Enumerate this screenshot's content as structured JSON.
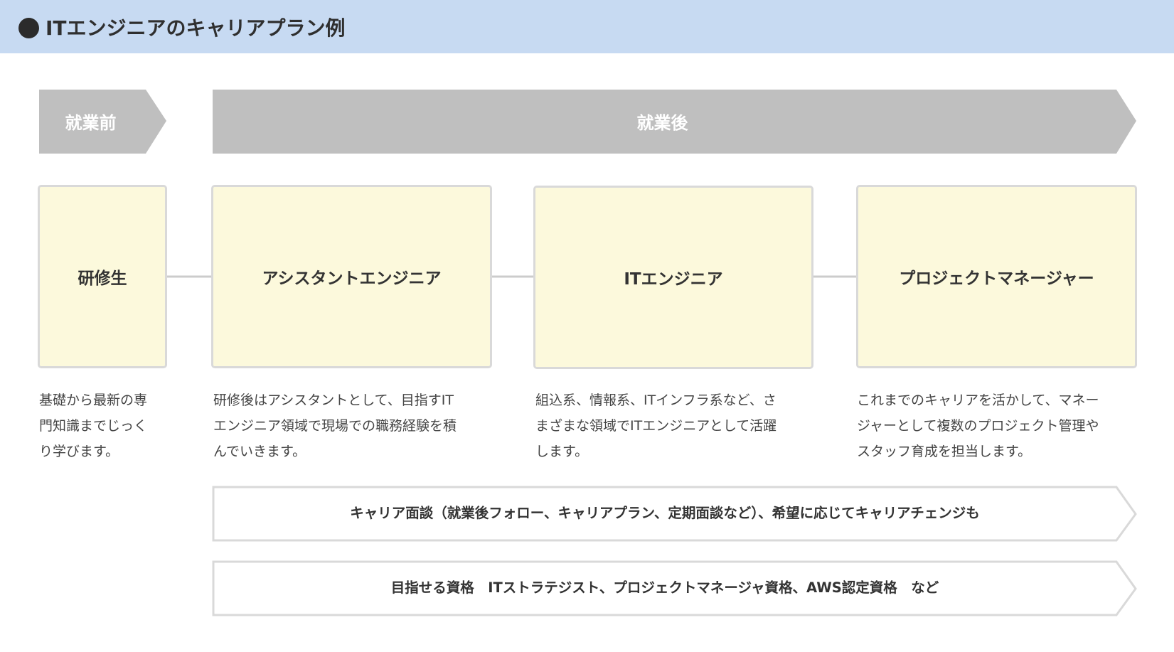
{
  "header": {
    "title": "ITエンジニアのキャリアプラン例"
  },
  "phases": [
    {
      "label": "就業前"
    },
    {
      "label": "就業後"
    }
  ],
  "steps": [
    {
      "title": "研修生",
      "description_lines": [
        "基礎から最新の専",
        "門知識までじっく",
        "り学びます。"
      ]
    },
    {
      "title": "アシスタントエンジニア",
      "description_lines": [
        "研修後はアシスタントとして、目指すIT",
        "エンジニア領域で現場での職務経験を積",
        "んでいきます。"
      ]
    },
    {
      "title": "ITエンジニア",
      "description_lines": [
        "組込系、情報系、ITインフラ系など、さ",
        "まざまな領域でITエンジニアとして活躍",
        "します。"
      ]
    },
    {
      "title": "プロジェクトマネージャー",
      "description_lines": [
        "これまでのキャリアを活かして、マネー",
        "ジャーとして複数のプロジェクト管理や",
        "スタッフ育成を担当します。"
      ]
    }
  ],
  "banners": [
    {
      "text": "キャリア面談（就業後フォロー、キャリアプラン、定期面談など）、希望に応じてキャリアチェンジも"
    },
    {
      "text": "目指せる資格　ITストラテジスト、プロジェクトマネージャ資格、AWS認定資格　など"
    }
  ],
  "colors": {
    "header_bg": "#c7daf2",
    "phase_arrow": "#bfbfbf",
    "step_fill": "#fcf9dc",
    "step_border": "#d9d9d9",
    "banner_border": "#d9d9d9"
  }
}
